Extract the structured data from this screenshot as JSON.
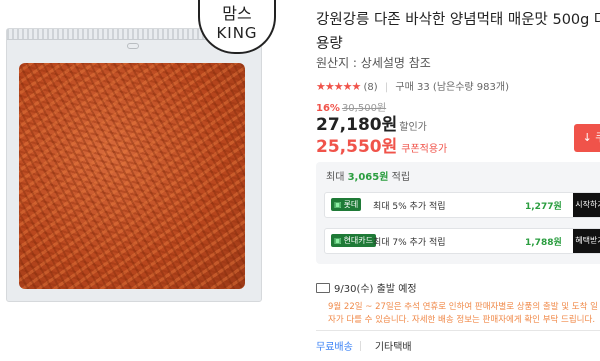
{
  "product": {
    "title": "강원강릉 다존 바삭한 양념먹태 매운맛 500g 대용량",
    "origin": "원산지 : 상세설명 참조",
    "rating": {
      "stars": "★★★★★",
      "review_count": "(8)",
      "purchase": "구매 33",
      "remaining": "(남은수량 983개)"
    },
    "price": {
      "discount_rate": "16%",
      "original": "30,500원",
      "sale": "27,180원",
      "sale_label": "할인가",
      "coupon": "25,550원",
      "coupon_label": "쿠폰적용가",
      "coupon_button": "쿠"
    },
    "logo": {
      "line1": "맘스",
      "line2": "KING"
    }
  },
  "points": {
    "title_prefix": "최대 ",
    "title_value": "3,065원",
    "title_suffix": " 적립",
    "cards": [
      {
        "badge_mark": "▣",
        "badge": "롯데",
        "desc": "최대 5% 추가 적립",
        "points": "1,277원",
        "button": "시작하기"
      },
      {
        "badge_mark": "▣",
        "badge": "현대카드",
        "desc": "최대 7% 추가 적립",
        "points": "1,788원",
        "button": "혜택받기"
      }
    ]
  },
  "shipping": {
    "date": "9/30(수) 출발 예정",
    "notice": "9월 22일 ~ 27일은 추석 연휴로 인하여 판매자별로 상품의 출발 및 도착 일자가 다를 수 있습니다. 자세한 배송 정보는 판매자에게 확인 부탁 드립니다.",
    "tab_free": "무료배송",
    "tab_other": "기타택배"
  }
}
